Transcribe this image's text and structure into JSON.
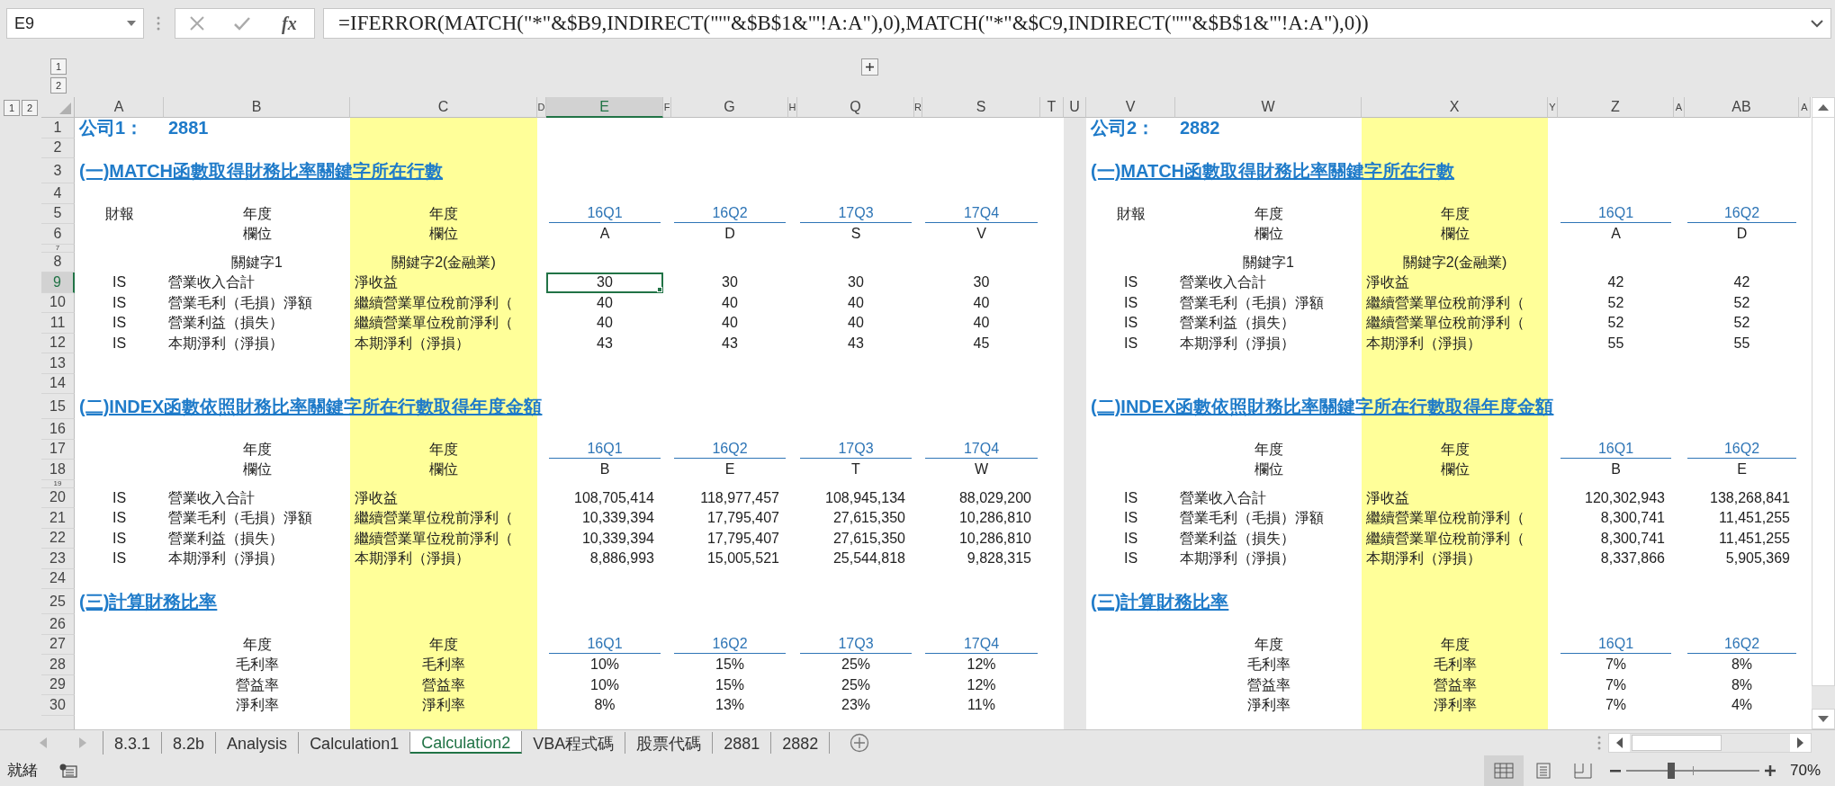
{
  "name_box": "E9",
  "function_button": "fx",
  "formula": "=IFERROR(MATCH(\"*\"&$B9,INDIRECT(\"'\"&$B$1&\"'!A:A\"),0),MATCH(\"*\"&$C9,INDIRECT(\"'\"&$B$1&\"'!A:A\"),0))",
  "column_level_buttons": [
    "1",
    "2"
  ],
  "row_level_buttons": [
    "1",
    "2"
  ],
  "columns": [
    {
      "label": "A",
      "selected": false,
      "highlighted": false
    },
    {
      "label": "B",
      "selected": false,
      "highlighted": false
    },
    {
      "label": "C",
      "selected": false,
      "highlighted": true
    },
    {
      "label": "D",
      "selected": false,
      "highlighted": false
    },
    {
      "label": "E",
      "selected": true,
      "highlighted": false
    },
    {
      "label": "F",
      "selected": false,
      "highlighted": false
    },
    {
      "label": "G",
      "selected": false,
      "highlighted": false
    },
    {
      "label": "H",
      "selected": false,
      "highlighted": false
    },
    {
      "label": "Q",
      "selected": false,
      "highlighted": false
    },
    {
      "label": "R",
      "selected": false,
      "highlighted": false
    },
    {
      "label": "S",
      "selected": false,
      "highlighted": false
    },
    {
      "label": "T",
      "selected": false,
      "highlighted": false
    },
    {
      "label": "U",
      "selected": false,
      "highlighted": false
    },
    {
      "label": "V",
      "selected": false,
      "highlighted": false
    },
    {
      "label": "W",
      "selected": false,
      "highlighted": false
    },
    {
      "label": "X",
      "selected": false,
      "highlighted": true
    },
    {
      "label": "Y",
      "selected": false,
      "highlighted": false
    },
    {
      "label": "Z",
      "selected": false,
      "highlighted": false
    },
    {
      "label": "A",
      "selected": false,
      "highlighted": false
    },
    {
      "label": "AB",
      "selected": false,
      "highlighted": false
    },
    {
      "label": "A",
      "selected": false,
      "highlighted": false
    }
  ],
  "rows": [
    {
      "number": "1",
      "selected": false,
      "kind": "company",
      "left": [
        {
          "kind": "label",
          "text": "公司1："
        },
        {
          "kind": "code",
          "text": "2881"
        }
      ],
      "right": [
        {
          "kind": "label",
          "text": "公司2："
        },
        {
          "kind": "code",
          "text": "2882"
        }
      ]
    },
    {
      "number": "2",
      "selected": false,
      "kind": "blank"
    },
    {
      "number": "3",
      "selected": false,
      "kind": "heading",
      "left": [
        {
          "kind": "heading",
          "text": "(一)MATCH函數取得財務比率關鍵字所在行數"
        }
      ],
      "right": [
        {
          "kind": "heading",
          "text": "(一)MATCH函數取得財務比率關鍵字所在行數"
        }
      ]
    },
    {
      "number": "4",
      "selected": false,
      "kind": "blank"
    },
    {
      "number": "5",
      "selected": false,
      "kind": "quarters",
      "left": [
        {
          "kind": "tag",
          "text": "財報"
        },
        {
          "kind": "key1",
          "text": "年度"
        },
        {
          "kind": "key2",
          "text": "年度"
        },
        {
          "kind": "value",
          "text": "16Q1"
        },
        {
          "kind": "value",
          "text": "16Q2"
        },
        {
          "kind": "value",
          "text": "17Q3"
        },
        {
          "kind": "value",
          "text": "17Q4"
        }
      ],
      "right": [
        {
          "kind": "tag",
          "text": "財報"
        },
        {
          "kind": "key1",
          "text": "年度"
        },
        {
          "kind": "key2",
          "text": "年度"
        },
        {
          "kind": "value",
          "text": "16Q1"
        },
        {
          "kind": "value",
          "text": "16Q2"
        }
      ]
    },
    {
      "number": "6",
      "selected": false,
      "kind": "letters",
      "left": [
        {
          "kind": "key1",
          "text": "欄位"
        },
        {
          "kind": "key2",
          "text": "欄位"
        },
        {
          "kind": "value",
          "text": "A"
        },
        {
          "kind": "value",
          "text": "D"
        },
        {
          "kind": "value",
          "text": "S"
        },
        {
          "kind": "value",
          "text": "V"
        }
      ],
      "right": [
        {
          "kind": "key1",
          "text": "欄位"
        },
        {
          "kind": "key2",
          "text": "欄位"
        },
        {
          "kind": "value",
          "text": "A"
        },
        {
          "kind": "value",
          "text": "D"
        }
      ]
    },
    {
      "number": "7",
      "selected": false,
      "kind": "spacer"
    },
    {
      "number": "8",
      "selected": false,
      "kind": "keywords",
      "left": [
        {
          "kind": "key1",
          "text": "關鍵字1"
        },
        {
          "kind": "key2",
          "text": "關鍵字2(金融業)"
        }
      ],
      "right": [
        {
          "kind": "key1",
          "text": "關鍵字1"
        },
        {
          "kind": "key2",
          "text": "關鍵字2(金融業)"
        }
      ]
    },
    {
      "number": "9",
      "selected": true,
      "kind": "counts",
      "left": [
        {
          "kind": "tag",
          "text": "IS"
        },
        {
          "kind": "key1",
          "text": "營業收入合計"
        },
        {
          "kind": "key2",
          "text": "淨收益"
        },
        {
          "kind": "value",
          "text": "30"
        },
        {
          "kind": "value",
          "text": "30"
        },
        {
          "kind": "value",
          "text": "30"
        },
        {
          "kind": "value",
          "text": "30"
        }
      ],
      "right": [
        {
          "kind": "tag",
          "text": "IS"
        },
        {
          "kind": "key1",
          "text": "營業收入合計"
        },
        {
          "kind": "key2",
          "text": "淨收益"
        },
        {
          "kind": "value",
          "text": "42"
        },
        {
          "kind": "value",
          "text": "42"
        }
      ]
    },
    {
      "number": "10",
      "selected": false,
      "kind": "counts",
      "left": [
        {
          "kind": "tag",
          "text": "IS"
        },
        {
          "kind": "key1",
          "text": "營業毛利（毛損）淨額"
        },
        {
          "kind": "key2",
          "text": "繼續營業單位稅前淨利（"
        },
        {
          "kind": "value",
          "text": "40"
        },
        {
          "kind": "value",
          "text": "40"
        },
        {
          "kind": "value",
          "text": "40"
        },
        {
          "kind": "value",
          "text": "40"
        }
      ],
      "right": [
        {
          "kind": "tag",
          "text": "IS"
        },
        {
          "kind": "key1",
          "text": "營業毛利（毛損）淨額"
        },
        {
          "kind": "key2",
          "text": "繼續營業單位稅前淨利（"
        },
        {
          "kind": "value",
          "text": "52"
        },
        {
          "kind": "value",
          "text": "52"
        }
      ]
    },
    {
      "number": "11",
      "selected": false,
      "kind": "counts",
      "left": [
        {
          "kind": "tag",
          "text": "IS"
        },
        {
          "kind": "key1",
          "text": "營業利益（損失）"
        },
        {
          "kind": "key2",
          "text": "繼續營業單位稅前淨利（"
        },
        {
          "kind": "value",
          "text": "40"
        },
        {
          "kind": "value",
          "text": "40"
        },
        {
          "kind": "value",
          "text": "40"
        },
        {
          "kind": "value",
          "text": "40"
        }
      ],
      "right": [
        {
          "kind": "tag",
          "text": "IS"
        },
        {
          "kind": "key1",
          "text": "營業利益（損失）"
        },
        {
          "kind": "key2",
          "text": "繼續營業單位稅前淨利（"
        },
        {
          "kind": "value",
          "text": "52"
        },
        {
          "kind": "value",
          "text": "52"
        }
      ]
    },
    {
      "number": "12",
      "selected": false,
      "kind": "counts",
      "left": [
        {
          "kind": "tag",
          "text": "IS"
        },
        {
          "kind": "key1",
          "text": "本期淨利（淨損）"
        },
        {
          "kind": "key2",
          "text": "本期淨利（淨損）"
        },
        {
          "kind": "value",
          "text": "43"
        },
        {
          "kind": "value",
          "text": "43"
        },
        {
          "kind": "value",
          "text": "43"
        },
        {
          "kind": "value",
          "text": "45"
        }
      ],
      "right": [
        {
          "kind": "tag",
          "text": "IS"
        },
        {
          "kind": "key1",
          "text": "本期淨利（淨損）"
        },
        {
          "kind": "key2",
          "text": "本期淨利（淨損）"
        },
        {
          "kind": "value",
          "text": "55"
        },
        {
          "kind": "value",
          "text": "55"
        }
      ]
    },
    {
      "number": "13",
      "selected": false,
      "kind": "blank"
    },
    {
      "number": "14",
      "selected": false,
      "kind": "blank"
    },
    {
      "number": "15",
      "selected": false,
      "kind": "heading",
      "left": [
        {
          "kind": "heading",
          "text": "(二)INDEX函數依照財務比率關鍵字所在行數取得年度金額"
        }
      ],
      "right": [
        {
          "kind": "heading",
          "text": "(二)INDEX函數依照財務比率關鍵字所在行數取得年度金額"
        }
      ]
    },
    {
      "number": "16",
      "selected": false,
      "kind": "blank"
    },
    {
      "number": "17",
      "selected": false,
      "kind": "quarters",
      "left": [
        {
          "kind": "key1",
          "text": "年度"
        },
        {
          "kind": "key2",
          "text": "年度"
        },
        {
          "kind": "value",
          "text": "16Q1"
        },
        {
          "kind": "value",
          "text": "16Q2"
        },
        {
          "kind": "value",
          "text": "17Q3"
        },
        {
          "kind": "value",
          "text": "17Q4"
        }
      ],
      "right": [
        {
          "kind": "key1",
          "text": "年度"
        },
        {
          "kind": "key2",
          "text": "年度"
        },
        {
          "kind": "value",
          "text": "16Q1"
        },
        {
          "kind": "value",
          "text": "16Q2"
        }
      ]
    },
    {
      "number": "18",
      "selected": false,
      "kind": "letters",
      "left": [
        {
          "kind": "key1",
          "text": "欄位"
        },
        {
          "kind": "key2",
          "text": "欄位"
        },
        {
          "kind": "value",
          "text": "B"
        },
        {
          "kind": "value",
          "text": "E"
        },
        {
          "kind": "value",
          "text": "T"
        },
        {
          "kind": "value",
          "text": "W"
        }
      ],
      "right": [
        {
          "kind": "key1",
          "text": "欄位"
        },
        {
          "kind": "key2",
          "text": "欄位"
        },
        {
          "kind": "value",
          "text": "B"
        },
        {
          "kind": "value",
          "text": "E"
        }
      ]
    },
    {
      "number": "19",
      "selected": false,
      "kind": "spacer"
    },
    {
      "number": "20",
      "selected": false,
      "kind": "amounts",
      "left": [
        {
          "kind": "tag",
          "text": "IS"
        },
        {
          "kind": "key1",
          "text": "營業收入合計"
        },
        {
          "kind": "key2",
          "text": "淨收益"
        },
        {
          "kind": "value",
          "text": "108,705,414"
        },
        {
          "kind": "value",
          "text": "118,977,457"
        },
        {
          "kind": "value",
          "text": "108,945,134"
        },
        {
          "kind": "value",
          "text": "88,029,200"
        }
      ],
      "right": [
        {
          "kind": "tag",
          "text": "IS"
        },
        {
          "kind": "key1",
          "text": "營業收入合計"
        },
        {
          "kind": "key2",
          "text": "淨收益"
        },
        {
          "kind": "value",
          "text": "120,302,943"
        },
        {
          "kind": "value",
          "text": "138,268,841"
        }
      ]
    },
    {
      "number": "21",
      "selected": false,
      "kind": "amounts",
      "left": [
        {
          "kind": "tag",
          "text": "IS"
        },
        {
          "kind": "key1",
          "text": "營業毛利（毛損）淨額"
        },
        {
          "kind": "key2",
          "text": "繼續營業單位稅前淨利（"
        },
        {
          "kind": "value",
          "text": "10,339,394"
        },
        {
          "kind": "value",
          "text": "17,795,407"
        },
        {
          "kind": "value",
          "text": "27,615,350"
        },
        {
          "kind": "value",
          "text": "10,286,810"
        }
      ],
      "right": [
        {
          "kind": "tag",
          "text": "IS"
        },
        {
          "kind": "key1",
          "text": "營業毛利（毛損）淨額"
        },
        {
          "kind": "key2",
          "text": "繼續營業單位稅前淨利（"
        },
        {
          "kind": "value",
          "text": "8,300,741"
        },
        {
          "kind": "value",
          "text": "11,451,255"
        }
      ]
    },
    {
      "number": "22",
      "selected": false,
      "kind": "amounts",
      "left": [
        {
          "kind": "tag",
          "text": "IS"
        },
        {
          "kind": "key1",
          "text": "營業利益（損失）"
        },
        {
          "kind": "key2",
          "text": "繼續營業單位稅前淨利（"
        },
        {
          "kind": "value",
          "text": "10,339,394"
        },
        {
          "kind": "value",
          "text": "17,795,407"
        },
        {
          "kind": "value",
          "text": "27,615,350"
        },
        {
          "kind": "value",
          "text": "10,286,810"
        }
      ],
      "right": [
        {
          "kind": "tag",
          "text": "IS"
        },
        {
          "kind": "key1",
          "text": "營業利益（損失）"
        },
        {
          "kind": "key2",
          "text": "繼續營業單位稅前淨利（"
        },
        {
          "kind": "value",
          "text": "8,300,741"
        },
        {
          "kind": "value",
          "text": "11,451,255"
        }
      ]
    },
    {
      "number": "23",
      "selected": false,
      "kind": "amounts",
      "left": [
        {
          "kind": "tag",
          "text": "IS"
        },
        {
          "kind": "key1",
          "text": "本期淨利（淨損）"
        },
        {
          "kind": "key2",
          "text": "本期淨利（淨損）"
        },
        {
          "kind": "value",
          "text": "8,886,993"
        },
        {
          "kind": "value",
          "text": "15,005,521"
        },
        {
          "kind": "value",
          "text": "25,544,818"
        },
        {
          "kind": "value",
          "text": "9,828,315"
        }
      ],
      "right": [
        {
          "kind": "tag",
          "text": "IS"
        },
        {
          "kind": "key1",
          "text": "本期淨利（淨損）"
        },
        {
          "kind": "key2",
          "text": "本期淨利（淨損）"
        },
        {
          "kind": "value",
          "text": "8,337,866"
        },
        {
          "kind": "value",
          "text": "5,905,369"
        }
      ]
    },
    {
      "number": "24",
      "selected": false,
      "kind": "blank"
    },
    {
      "number": "25",
      "selected": false,
      "kind": "heading",
      "left": [
        {
          "kind": "heading",
          "text": "(三)計算財務比率"
        }
      ],
      "right": [
        {
          "kind": "heading",
          "text": "(三)計算財務比率"
        }
      ]
    },
    {
      "number": "26",
      "selected": false,
      "kind": "blank"
    },
    {
      "number": "27",
      "selected": false,
      "kind": "quarters",
      "left": [
        {
          "kind": "key1",
          "text": "年度"
        },
        {
          "kind": "key2",
          "text": "年度"
        },
        {
          "kind": "value",
          "text": "16Q1"
        },
        {
          "kind": "value",
          "text": "16Q2"
        },
        {
          "kind": "value",
          "text": "17Q3"
        },
        {
          "kind": "value",
          "text": "17Q4"
        }
      ],
      "right": [
        {
          "kind": "key1",
          "text": "年度"
        },
        {
          "kind": "key2",
          "text": "年度"
        },
        {
          "kind": "value",
          "text": "16Q1"
        },
        {
          "kind": "value",
          "text": "16Q2"
        }
      ]
    },
    {
      "number": "28",
      "selected": false,
      "kind": "ratios",
      "left": [
        {
          "kind": "key1",
          "text": "毛利率"
        },
        {
          "kind": "key2",
          "text": "毛利率"
        },
        {
          "kind": "value",
          "text": "10%"
        },
        {
          "kind": "value",
          "text": "15%"
        },
        {
          "kind": "value",
          "text": "25%"
        },
        {
          "kind": "value",
          "text": "12%"
        }
      ],
      "right": [
        {
          "kind": "key1",
          "text": "毛利率"
        },
        {
          "kind": "key2",
          "text": "毛利率"
        },
        {
          "kind": "value",
          "text": "7%"
        },
        {
          "kind": "value",
          "text": "8%"
        }
      ]
    },
    {
      "number": "29",
      "selected": false,
      "kind": "ratios",
      "left": [
        {
          "kind": "key1",
          "text": "營益率"
        },
        {
          "kind": "key2",
          "text": "營益率"
        },
        {
          "kind": "value",
          "text": "10%"
        },
        {
          "kind": "value",
          "text": "15%"
        },
        {
          "kind": "value",
          "text": "25%"
        },
        {
          "kind": "value",
          "text": "12%"
        }
      ],
      "right": [
        {
          "kind": "key1",
          "text": "營益率"
        },
        {
          "kind": "key2",
          "text": "營益率"
        },
        {
          "kind": "value",
          "text": "7%"
        },
        {
          "kind": "value",
          "text": "8%"
        }
      ]
    },
    {
      "number": "30",
      "selected": false,
      "kind": "ratios",
      "left": [
        {
          "kind": "key1",
          "text": "淨利率"
        },
        {
          "kind": "key2",
          "text": "淨利率"
        },
        {
          "kind": "value",
          "text": "8%"
        },
        {
          "kind": "value",
          "text": "13%"
        },
        {
          "kind": "value",
          "text": "23%"
        },
        {
          "kind": "value",
          "text": "11%"
        }
      ],
      "right": [
        {
          "kind": "key1",
          "text": "淨利率"
        },
        {
          "kind": "key2",
          "text": "淨利率"
        },
        {
          "kind": "value",
          "text": "7%"
        },
        {
          "kind": "value",
          "text": "4%"
        }
      ]
    }
  ],
  "sheet_tabs": [
    {
      "label": "8.3.1",
      "selected": false
    },
    {
      "label": "8.2b",
      "selected": false
    },
    {
      "label": "Analysis",
      "selected": false
    },
    {
      "label": "Calculation1",
      "selected": false
    },
    {
      "label": "Calculation2",
      "selected": true
    },
    {
      "label": "VBA程式碼",
      "selected": false
    },
    {
      "label": "股票代碼",
      "selected": false
    },
    {
      "label": "2881",
      "selected": false
    },
    {
      "label": "2882",
      "selected": false
    }
  ],
  "status": "就緒",
  "zoom_slider": {
    "level": 0.34
  },
  "zoom": "70%"
}
